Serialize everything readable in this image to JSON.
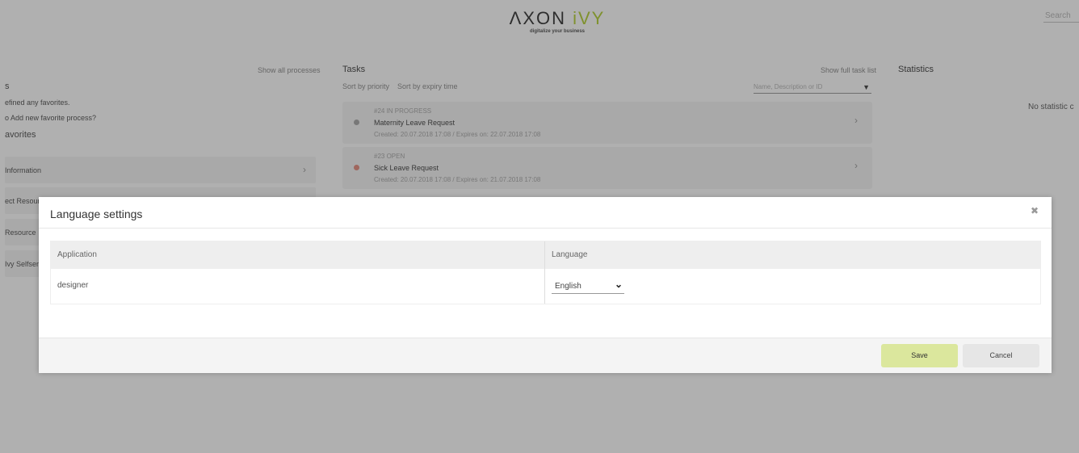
{
  "header": {
    "logo_prefix": "ΛXON ",
    "logo_accent": "iVY",
    "tagline": "digitalize your business",
    "search_placeholder": "Search"
  },
  "processes": {
    "show_all": "Show all processes",
    "title_fragment": "s",
    "no_favorites": "efined any favorites.",
    "add_hint": "o Add new favorite process?",
    "favorites_heading": "avorites",
    "items": [
      {
        "label": "Information"
      },
      {
        "label": "ect Resource"
      },
      {
        "label": "Resource"
      },
      {
        "label": "Ivy Selfserv"
      }
    ]
  },
  "tasks": {
    "title": "Tasks",
    "show_full": "Show full task list",
    "sort_priority": "Sort by priority",
    "sort_expiry": "Sort by expiry time",
    "filter_placeholder": "Name, Description or ID",
    "items": [
      {
        "id_state": "#24 IN PROGRESS",
        "name": "Maternity Leave Request",
        "meta": "Created: 20.07.2018 17:08 / Expires on: 22.07.2018 17:08",
        "dot_color": "#999999"
      },
      {
        "id_state": "#23 OPEN",
        "name": "Sick Leave Request",
        "meta": "Created: 20.07.2018 17:08 / Expires on: 21.07.2018 17:08",
        "dot_color": "#e07a6a"
      }
    ]
  },
  "statistics": {
    "title": "Statistics",
    "empty": "No statistic c"
  },
  "dialog": {
    "title": "Language settings",
    "columns": {
      "application": "Application",
      "language": "Language"
    },
    "row": {
      "application": "designer",
      "language": "English"
    },
    "save_label": "Save",
    "cancel_label": "Cancel"
  },
  "colors": {
    "accent": "#a6c613",
    "save_button": "#dbe79d"
  }
}
